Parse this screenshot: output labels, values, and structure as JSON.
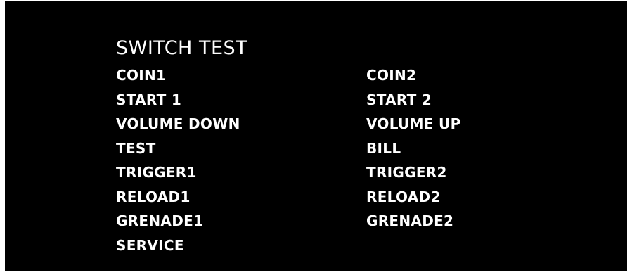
{
  "screen": {
    "title": "SWITCH TEST",
    "left_column": [
      "COIN1",
      "START 1",
      "VOLUME DOWN",
      "TEST",
      "TRIGGER1",
      "RELOAD1",
      "GRENADE1",
      "SERVICE"
    ],
    "right_column": [
      "COIN2",
      "START 2",
      "VOLUME UP",
      "BILL",
      "TRIGGER2",
      "RELOAD2",
      "GRENADE2"
    ],
    "colors": {
      "background": "#000000",
      "text": "#ffffff",
      "frame": "#ffffff"
    }
  }
}
